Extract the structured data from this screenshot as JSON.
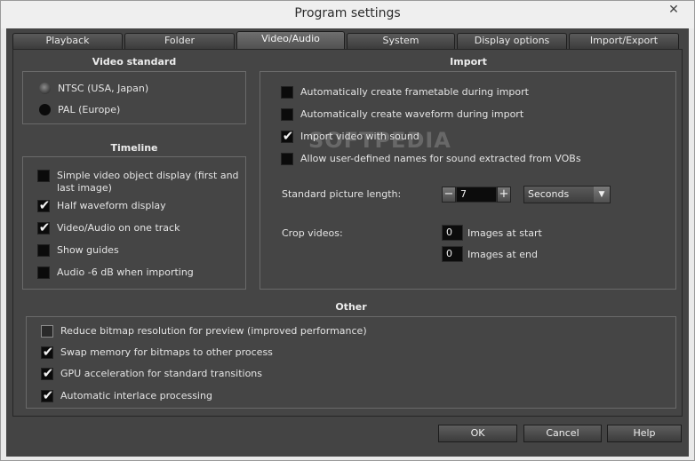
{
  "window": {
    "title": "Program settings",
    "close_glyph": "✕"
  },
  "tabs": [
    {
      "label": "Playback",
      "active": false
    },
    {
      "label": "Folder",
      "active": false
    },
    {
      "label": "Video/Audio",
      "active": true
    },
    {
      "label": "System",
      "active": false
    },
    {
      "label": "Display options",
      "active": false
    },
    {
      "label": "Import/Export",
      "active": false
    }
  ],
  "video_standard": {
    "title": "Video standard",
    "options": [
      {
        "label": "NTSC (USA, Japan)",
        "selected": true
      },
      {
        "label": "PAL (Europe)",
        "selected": false
      }
    ]
  },
  "timeline": {
    "title": "Timeline",
    "items": [
      {
        "label_line1": "Simple video object display (first and",
        "label_line2": "last image)",
        "checked": false
      },
      {
        "label": "Half waveform display",
        "checked": true
      },
      {
        "label": "Video/Audio on one track",
        "checked": true
      },
      {
        "label": "Show guides",
        "checked": false
      },
      {
        "label": "Audio -6 dB when importing",
        "checked": false
      }
    ]
  },
  "import": {
    "title": "Import",
    "items": [
      {
        "label": "Automatically create frametable during import",
        "checked": false
      },
      {
        "label": "Automatically create waveform during import",
        "checked": false
      },
      {
        "label": "Import video with sound",
        "checked": true
      },
      {
        "label": "Allow user-defined names for sound extracted from VOBs",
        "checked": false
      }
    ],
    "picture_length": {
      "label": "Standard picture length:",
      "value": "7",
      "minus": "−",
      "plus": "+",
      "unit": "Seconds",
      "unit_arrow": "▼"
    },
    "crop": {
      "label": "Crop videos:",
      "start_value": "0",
      "start_label": "Images at start",
      "end_value": "0",
      "end_label": "Images at end"
    }
  },
  "other": {
    "title": "Other",
    "items": [
      {
        "label": "Reduce bitmap resolution for preview (improved performance)",
        "checked": false
      },
      {
        "label": "Swap memory for bitmaps to other process",
        "checked": true
      },
      {
        "label": "GPU acceleration for standard transitions",
        "checked": true
      },
      {
        "label": "Automatic interlace processing",
        "checked": true
      }
    ]
  },
  "buttons": {
    "ok": "OK",
    "cancel": "Cancel",
    "help": "Help"
  },
  "watermark": "SOFTPEDIA",
  "check_glyph": "✔"
}
